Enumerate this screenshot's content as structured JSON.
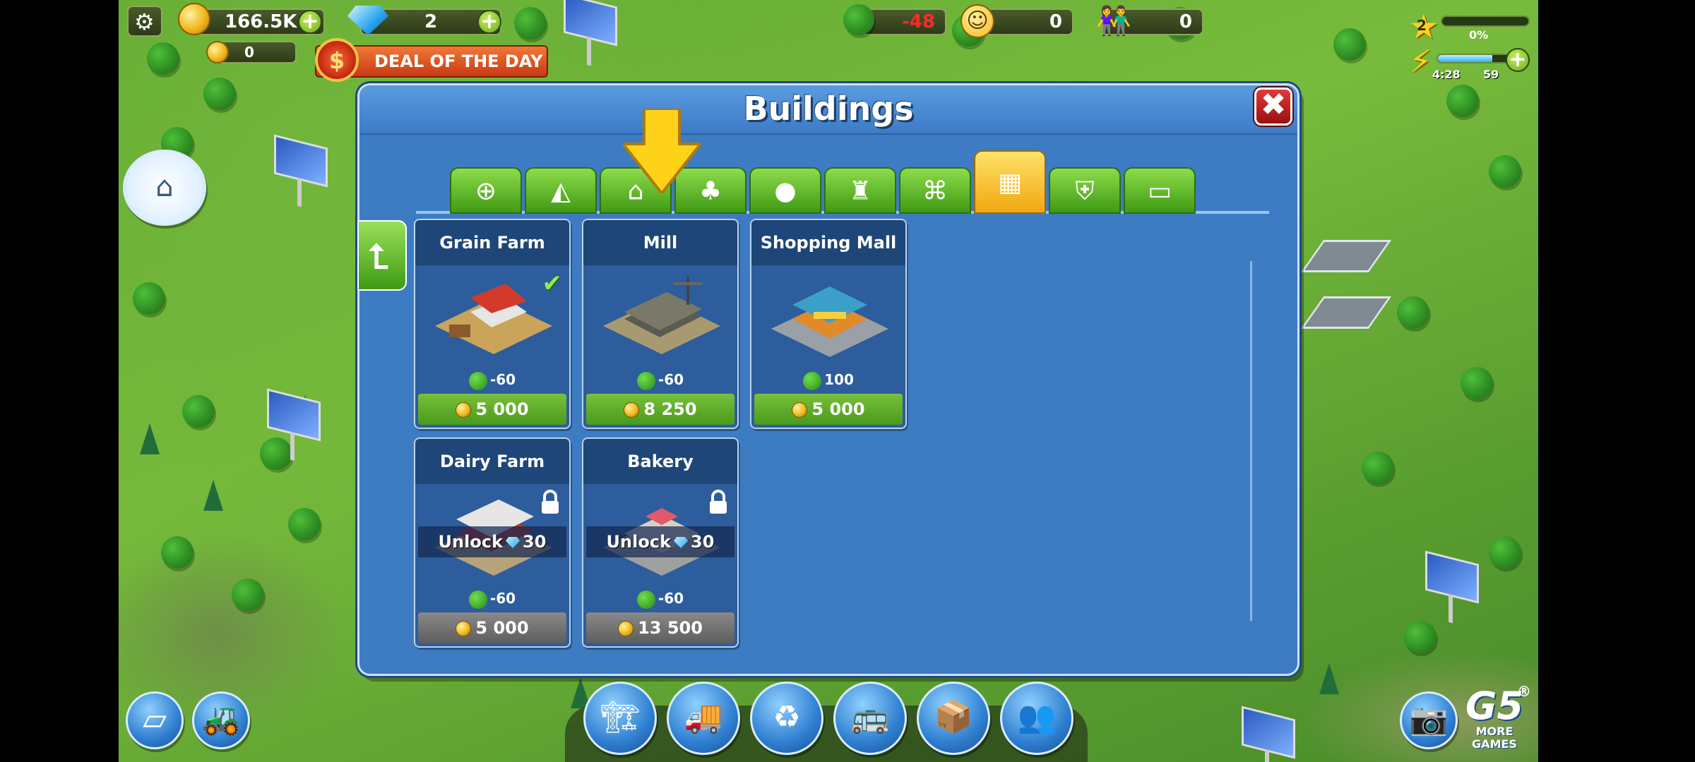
{
  "hud": {
    "coins": "166.5K",
    "gems": "2",
    "small_coins": "0",
    "ecology": "-48",
    "happiness": "0",
    "population": "0",
    "deal_label": "DEAL OF THE DAY",
    "level": "2",
    "xp_percent": "0%",
    "energy_timer": "4:28",
    "energy_value": "59"
  },
  "dialog": {
    "title": "Buildings",
    "close_symbol": "✖",
    "tabs": [
      {
        "name": "tab-new-buildings",
        "icon": "document-plus-icon"
      },
      {
        "name": "tab-residential",
        "icon": "house-shapes-icon"
      },
      {
        "name": "tab-commercial",
        "icon": "shop-icon"
      },
      {
        "name": "tab-decorations",
        "icon": "tree-bench-icon"
      },
      {
        "name": "tab-leisure",
        "icon": "bowling-icon"
      },
      {
        "name": "tab-infrastructure",
        "icon": "tower-icon"
      },
      {
        "name": "tab-municipal",
        "icon": "government-building-icon"
      },
      {
        "name": "tab-industrial",
        "icon": "factory-icon",
        "active": true
      },
      {
        "name": "tab-services",
        "icon": "shield-plus-icon"
      },
      {
        "name": "tab-energy",
        "icon": "battery-icon"
      }
    ]
  },
  "buildings": [
    {
      "name": "Grain Farm",
      "eco": "-60",
      "price": "5 000",
      "owned": true
    },
    {
      "name": "Mill",
      "eco": "-60",
      "price": "8 250"
    },
    {
      "name": "Shopping Mall",
      "eco": "100",
      "price": "5 000"
    },
    {
      "name": "Dairy Farm",
      "eco": "-60",
      "price": "5 000",
      "locked": true,
      "unlock_label": "Unlock",
      "unlock_cost": "30"
    },
    {
      "name": "Bakery",
      "eco": "-60",
      "price": "13 500",
      "locked": true,
      "unlock_label": "Unlock",
      "unlock_cost": "30"
    }
  ],
  "bottom": {
    "g5_logo": "G5",
    "more_games": "MORE GAMES",
    "registered": "®"
  },
  "colors": {
    "accent_green": "#4a9a1c",
    "dialog_blue": "#3d7cc3",
    "active_tab": "#f0a810",
    "eco_negative": "#ff2a2a"
  }
}
